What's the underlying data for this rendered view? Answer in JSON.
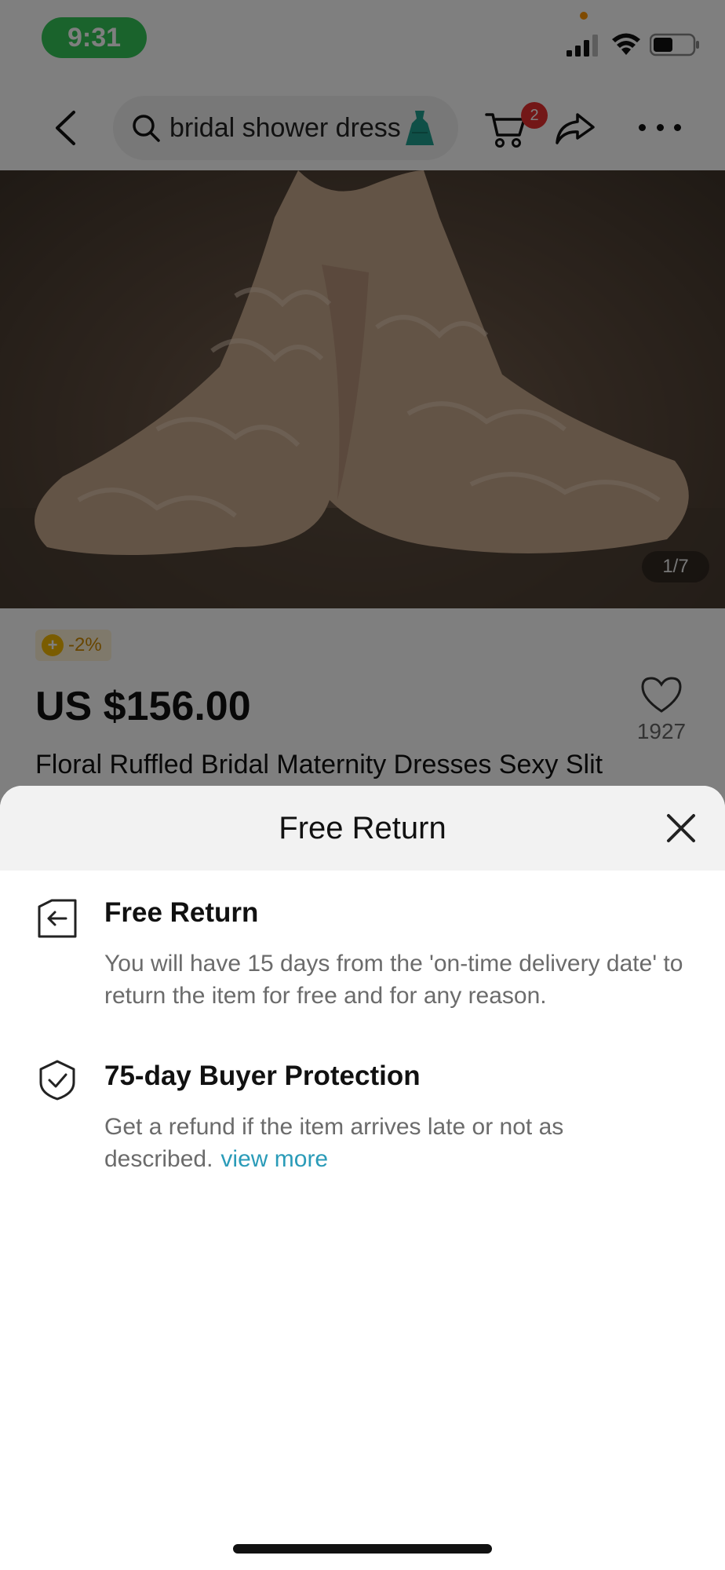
{
  "status_bar": {
    "time": "9:31"
  },
  "nav": {
    "search_query": "bridal shower dress",
    "cart_badge": "2"
  },
  "product": {
    "image_counter": "1/7",
    "discount": "-2%",
    "price": "US $156.00",
    "favorites_count": "1927",
    "title": "Floral Ruffled Bridal Maternity Dresses Sexy Slit"
  },
  "sheet": {
    "title": "Free Return",
    "features": [
      {
        "icon": "return-box-icon",
        "title": "Free Return",
        "description": "You will have 15 days from the 'on-time delivery date' to return the item for free and for any reason."
      },
      {
        "icon": "shield-check-icon",
        "title": "75-day Buyer Protection",
        "description": "Get a refund if the item arrives late or not as described.",
        "link": "view more"
      }
    ]
  },
  "colors": {
    "status_pill": "#34c759",
    "badge": "#e62e2e",
    "link": "#2a9bb8",
    "header_bg": "#f2f2f2"
  }
}
